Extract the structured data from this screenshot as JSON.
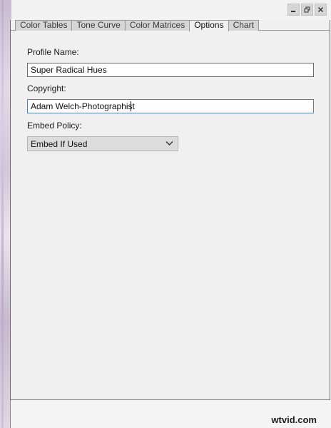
{
  "window_controls": {
    "minimize_icon": "minimize-icon",
    "restore_icon": "restore-icon",
    "close_icon": "close-icon"
  },
  "tabs": [
    {
      "label": "Color Tables",
      "active": false
    },
    {
      "label": "Tone Curve",
      "active": false
    },
    {
      "label": "Color Matrices",
      "active": false
    },
    {
      "label": "Options",
      "active": true
    },
    {
      "label": "Chart",
      "active": false
    }
  ],
  "form": {
    "profile_name": {
      "label": "Profile Name:",
      "value": "Super Radical Hues"
    },
    "copyright": {
      "label": "Copyright:",
      "value": "Adam Welch-Photographist"
    },
    "embed_policy": {
      "label": "Embed Policy:",
      "value": "Embed If Used"
    }
  },
  "watermark": "wtvid.com",
  "colors": {
    "panel_bg": "#f0f0f0",
    "tab_inactive": "#d6d6d6",
    "focus_border": "#5a7db0"
  }
}
